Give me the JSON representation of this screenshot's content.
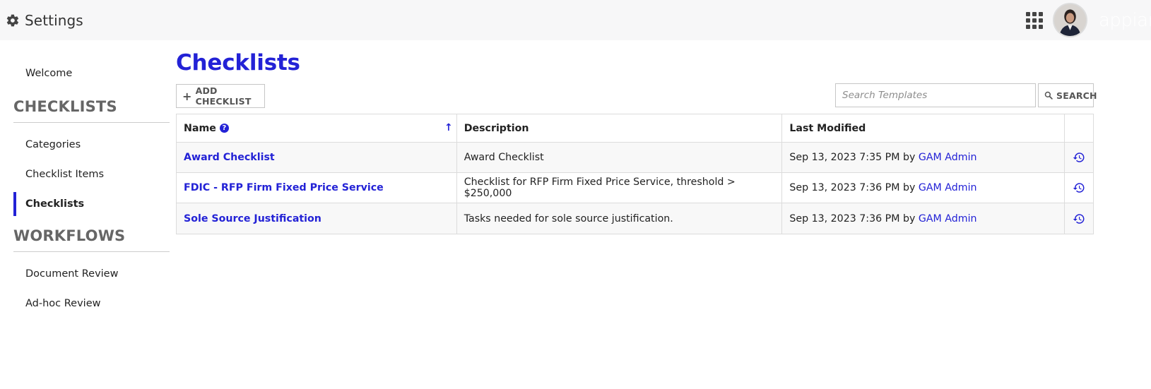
{
  "header": {
    "title": "Settings",
    "brand_logo": "appian",
    "icons": {
      "settings": "gear-icon",
      "apps": "grid-icon",
      "avatar": "user-avatar"
    }
  },
  "sidebar": {
    "welcome": "Welcome",
    "sections": [
      {
        "heading": "CHECKLISTS",
        "items": [
          {
            "label": "Categories",
            "active": false
          },
          {
            "label": "Checklist Items",
            "active": false
          },
          {
            "label": "Checklists",
            "active": true
          }
        ]
      },
      {
        "heading": "WORKFLOWS",
        "items": [
          {
            "label": "Document Review",
            "active": false
          },
          {
            "label": "Ad-hoc Review",
            "active": false
          }
        ]
      }
    ]
  },
  "main": {
    "title": "Checklists",
    "add_button": "ADD CHECKLIST",
    "search": {
      "placeholder": "Search Templates",
      "value": "",
      "button": "SEARCH"
    },
    "table": {
      "columns": [
        "Name",
        "Description",
        "Last Modified"
      ],
      "rows": [
        {
          "name": "Award Checklist",
          "description": "Award Checklist",
          "modified": "Sep 13, 2023 7:35 PM by ",
          "user": "GAM Admin"
        },
        {
          "name": "FDIC - RFP Firm Fixed Price Service",
          "description": "Checklist for RFP Firm Fixed Price Service, threshold > $250,000",
          "modified": "Sep 13, 2023 7:36 PM by ",
          "user": "GAM Admin"
        },
        {
          "name": "Sole Source Justification",
          "description": "Tasks needed for sole source justification.",
          "modified": "Sep 13, 2023 7:36 PM by ",
          "user": "GAM Admin"
        }
      ]
    }
  },
  "colors": {
    "accent": "#2322d6",
    "header_bg": "#f7f7f8",
    "heading_gray": "#666666"
  }
}
